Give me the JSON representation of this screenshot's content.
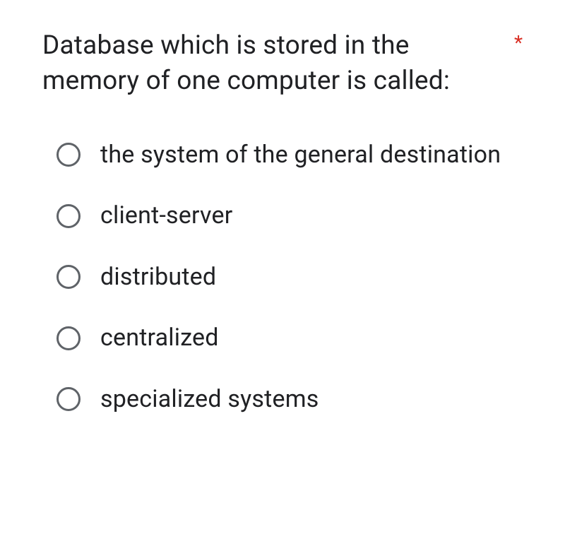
{
  "question": {
    "text": "Database which is stored in the memory of one computer is called:",
    "required_mark": "*"
  },
  "options": [
    {
      "label": "the system of the general destination"
    },
    {
      "label": "client-server"
    },
    {
      "label": "distributed"
    },
    {
      "label": "centralized"
    },
    {
      "label": "specialized systems"
    }
  ]
}
